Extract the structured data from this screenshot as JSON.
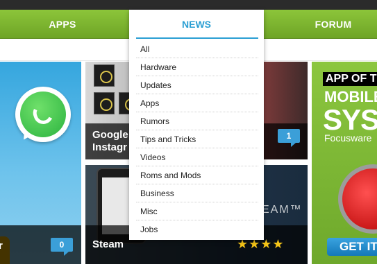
{
  "colors": {
    "nav_green": "#7cb631",
    "accent_blue": "#2b9fd3",
    "badge_blue": "#3b9fd8",
    "star_yellow": "#f5c518"
  },
  "nav": {
    "apps": "APPS",
    "news": "NEWS",
    "forum": "FORUM"
  },
  "news_menu": {
    "items": [
      {
        "label": "All"
      },
      {
        "label": "Hardware"
      },
      {
        "label": "Updates"
      },
      {
        "label": "Apps"
      },
      {
        "label": "Rumors"
      },
      {
        "label": "Tips and Tricks"
      },
      {
        "label": "Videos"
      },
      {
        "label": "Roms and Mods"
      },
      {
        "label": "Business"
      },
      {
        "label": "Misc"
      },
      {
        "label": "Jobs"
      }
    ]
  },
  "tiles": {
    "whatsapp": {
      "caption": "r",
      "comments": "0",
      "icon": "whatsapp-logo-icon"
    },
    "google": {
      "caption_line1": "Google",
      "caption_line2": "Instagr",
      "comments": "1"
    },
    "steam": {
      "caption": "Steam",
      "logo_text": "EAM™",
      "rating_stars": 4
    },
    "app_of_day": {
      "banner": "APP OF T",
      "line1": "MOBILE",
      "line2": "SYST",
      "line3": "Focusware",
      "button": "GET IT"
    }
  }
}
